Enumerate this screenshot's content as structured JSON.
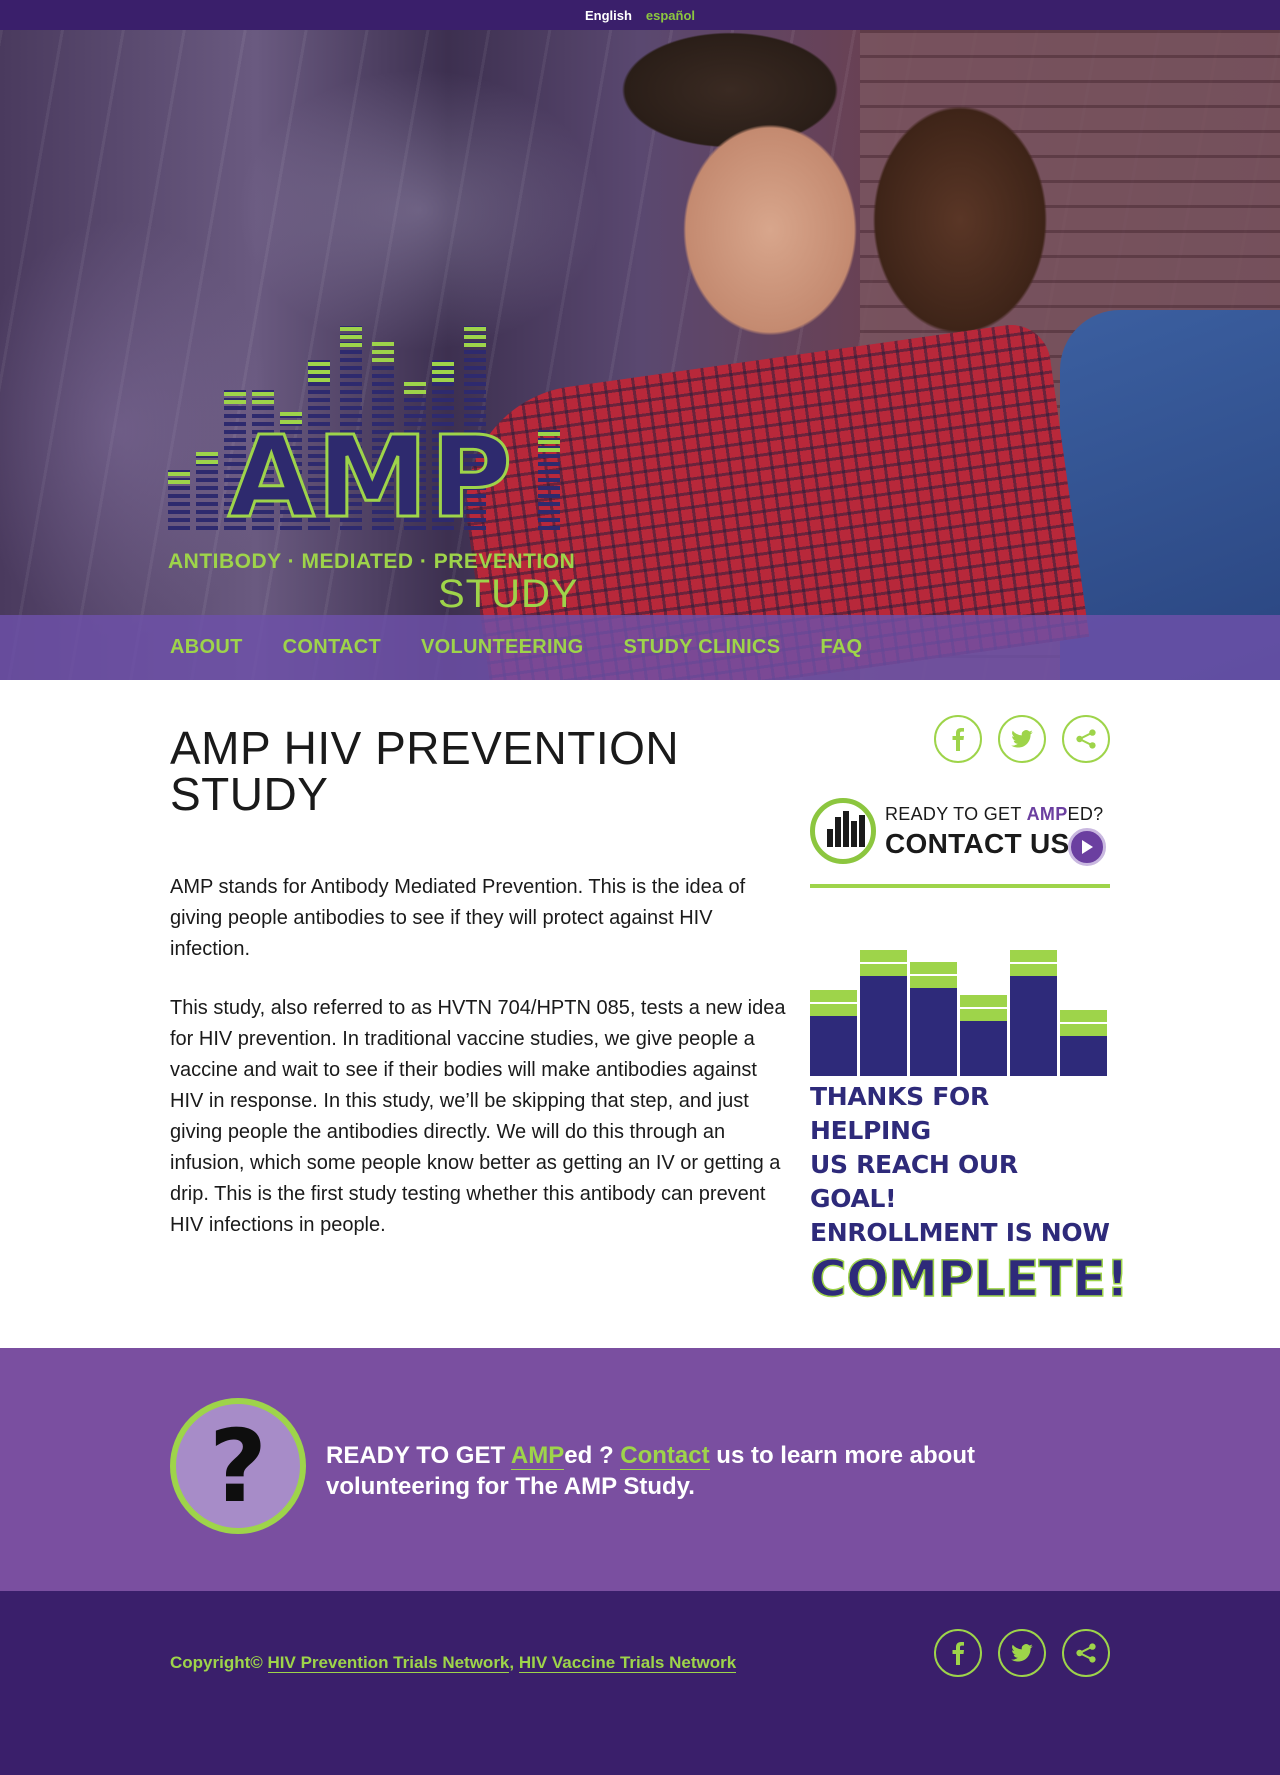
{
  "language_bar": {
    "english": "English",
    "spanish": "español"
  },
  "logo": {
    "title": "AMP",
    "subtitle": "ANTIBODY · MEDIATED · PREVENTION",
    "study": "STUDY"
  },
  "nav": {
    "items": [
      "ABOUT",
      "CONTACT",
      "VOLUNTEERING",
      "STUDY CLINICS",
      "FAQ"
    ]
  },
  "main": {
    "title": "AMP HIV PREVENTION STUDY",
    "paragraphs": [
      "AMP stands for Antibody Mediated Prevention. This is the idea of giving people antibodies to see if they will protect against HIV infection.",
      "This study, also referred to as HVTN 704/HPTN 085, tests a new idea for HIV prevention. In traditional vaccine studies, we give people a vaccine and wait to see if their bodies will make antibodies against HIV in response. In this study, we’ll be skipping that step, and just giving people the antibodies directly. We will do this through an infusion, which some people know better as getting an IV or getting a drip. This is the first study testing whether this antibody can prevent HIV infections in people."
    ]
  },
  "sidebar": {
    "social_icons": [
      "facebook-icon",
      "twitter-icon",
      "share-icon"
    ],
    "ready_prefix": "READY TO GET ",
    "ready_amp": "AMP",
    "ready_suffix": "ED?",
    "contact_us": "CONTACT US",
    "goal_lines": [
      "THANKS FOR HELPING",
      "US REACH OUR GOAL!",
      "ENROLLMENT IS NOW"
    ],
    "goal_complete": "COMPLETE!"
  },
  "cta": {
    "icon": "?",
    "prefix": "READY TO GET ",
    "amp_link": "AMP",
    "mid": "ed ? ",
    "contact_link": "Contact",
    "suffix": " us to learn more about volunteering for The AMP Study."
  },
  "footer": {
    "copyright": "Copyright© ",
    "link1": "HIV Prevention Trials Network",
    "sep": ", ",
    "link2": "HIV Vaccine Trials Network"
  },
  "colors": {
    "purple_dark": "#3a1f6b",
    "purple": "#7a4fa0",
    "green": "#9ed44a",
    "navy": "#2e2a7a"
  }
}
